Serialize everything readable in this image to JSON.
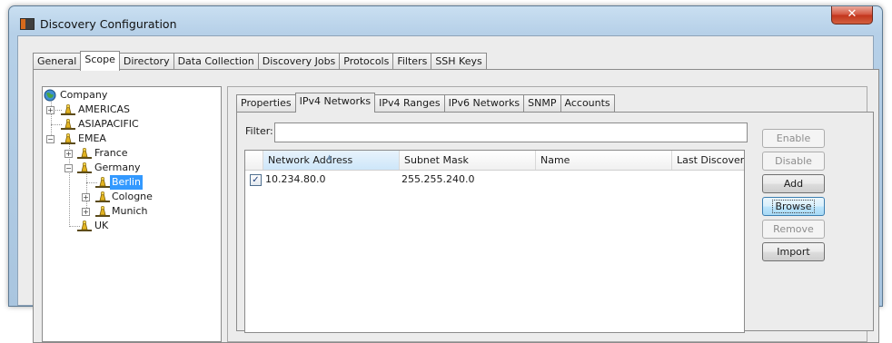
{
  "window": {
    "title": "Discovery Configuration",
    "close_glyph": "✕"
  },
  "main_tabs": [
    "General",
    "Scope",
    "Directory",
    "Data Collection",
    "Discovery Jobs",
    "Protocols",
    "Filters",
    "SSH Keys"
  ],
  "main_active_tab": "Scope",
  "tree": {
    "root": "Company",
    "nodes": [
      "AMERICAS",
      "ASIAPACIFIC",
      "EMEA",
      "France",
      "Germany",
      "Berlin",
      "Cologne",
      "Munich",
      "UK"
    ],
    "selected": "Berlin"
  },
  "scope_tabs": [
    "Properties",
    "IPv4 Networks",
    "IPv4 Ranges",
    "IPv6 Networks",
    "SNMP",
    "Accounts"
  ],
  "scope_active_tab": "IPv4 Networks",
  "filter": {
    "label": "Filter:",
    "value": ""
  },
  "table": {
    "columns": [
      "Network Address",
      "Subnet Mask",
      "Name",
      "Last Discovered"
    ],
    "sorted_column": "Network Address",
    "rows": [
      {
        "checked": true,
        "network": "10.234.80.0",
        "mask": "255.255.240.0",
        "name": "",
        "last": ""
      }
    ]
  },
  "buttons": {
    "enable": "Enable",
    "disable": "Disable",
    "add": "Add",
    "browse": "Browse",
    "remove": "Remove",
    "import": "Import"
  },
  "icons": {
    "checkmark": "✓",
    "sort": "▲",
    "expand": "+",
    "collapse": "−"
  }
}
